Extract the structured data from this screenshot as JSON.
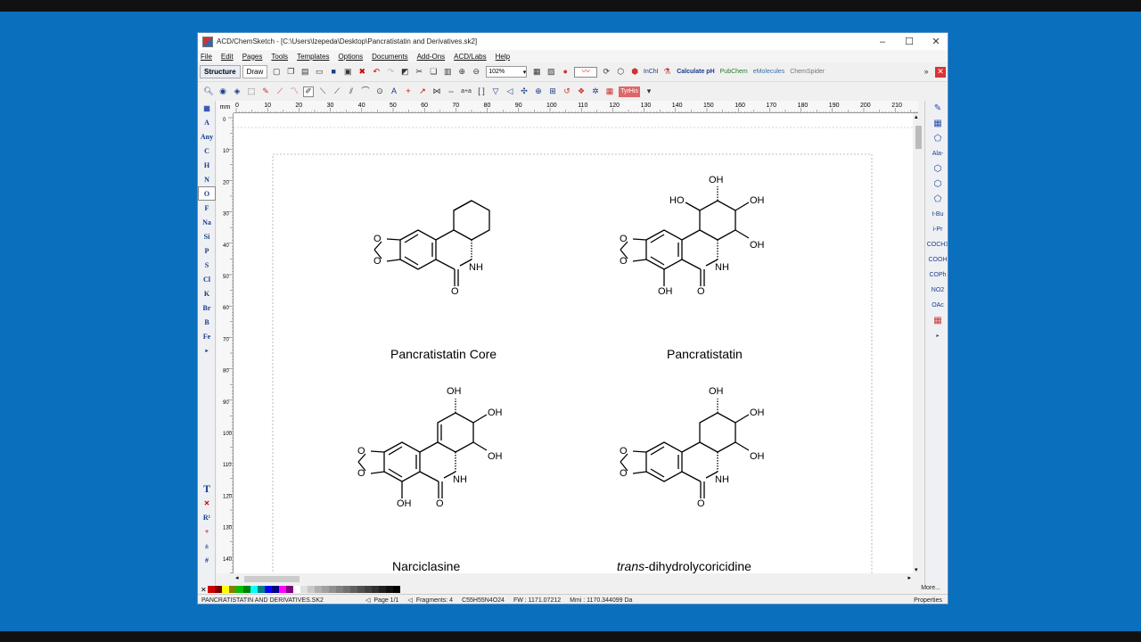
{
  "window": {
    "title": "ACD/ChemSketch - [C:\\Users\\lzepeda\\Desktop\\Pancratistatin and Derivatives.sk2]",
    "controls": [
      "–",
      "☐",
      "✕"
    ]
  },
  "menu": [
    "File",
    "Edit",
    "Pages",
    "Tools",
    "Templates",
    "Options",
    "Documents",
    "Add-Ons",
    "ACD/Labs",
    "Help"
  ],
  "toolbar": {
    "mode_structure": "Structure",
    "mode_draw": "Draw",
    "zoom": "102%",
    "calculate_ph": "Calculate pH",
    "pubchem": "PubChem",
    "emolecules": "eMolecules",
    "chemspider": "ChemSpider"
  },
  "left_palette": [
    "A",
    "Any",
    "C",
    "H",
    "N",
    "O",
    "F",
    "Na",
    "Si",
    "P",
    "S",
    "Cl",
    "K",
    "Br",
    "B",
    "Fe"
  ],
  "left_palette_selected": "O",
  "left_palette_bottom": [
    "T",
    "✕",
    "R¹",
    "+",
    "±",
    "#"
  ],
  "right_palette": [
    "Ala-",
    "t-Bu",
    "i-Pr",
    "COCH3",
    "COOH",
    "COPh",
    "NO2",
    "OAc"
  ],
  "ruler": {
    "unit": "mm",
    "h_ticks": [
      "0",
      "10",
      "20",
      "30",
      "40",
      "50",
      "60",
      "70",
      "80",
      "90",
      "100",
      "110",
      "120",
      "130",
      "140",
      "150",
      "160",
      "170",
      "180",
      "190",
      "200",
      "210",
      "22"
    ],
    "v_ticks": [
      "0",
      "10",
      "20",
      "30",
      "40",
      "50",
      "60",
      "70",
      "80",
      "90",
      "100",
      "110",
      "120",
      "130",
      "140"
    ]
  },
  "molecules": [
    {
      "name": "Pancratistatin Core"
    },
    {
      "name": "Pancratistatin"
    },
    {
      "name": "Narciclasine"
    },
    {
      "name_italic": "trans",
      "name_rest": "-dihydrolycoricidine"
    }
  ],
  "atom_labels": {
    "O": "O",
    "NH": "NH",
    "OH": "OH",
    "HO": "HO"
  },
  "status": {
    "file": "PANCRATISTATIN AND DERIVATIVES.SK2",
    "page": "Page 1/1",
    "fragments": "Fragments: 4",
    "formula": "C55H55N4O24",
    "fw": "FW : 1171.07212",
    "mmi": "Mmi : 1170.344099 Da",
    "properties": "Properties"
  },
  "colorbar": {
    "more": "More...",
    "colors": [
      "#d00000",
      "#800000",
      "#ffff00",
      "#808000",
      "#00c000",
      "#008000",
      "#00ffff",
      "#008080",
      "#0000ff",
      "#000080",
      "#ff00ff",
      "#800080",
      "#ffffff",
      "#e0e0e0",
      "#c8c8c8",
      "#b0b0b0",
      "#a0a0a0",
      "#909090",
      "#808080",
      "#707070",
      "#606060",
      "#505050",
      "#404040",
      "#303030",
      "#202020",
      "#101010",
      "#000000"
    ]
  }
}
